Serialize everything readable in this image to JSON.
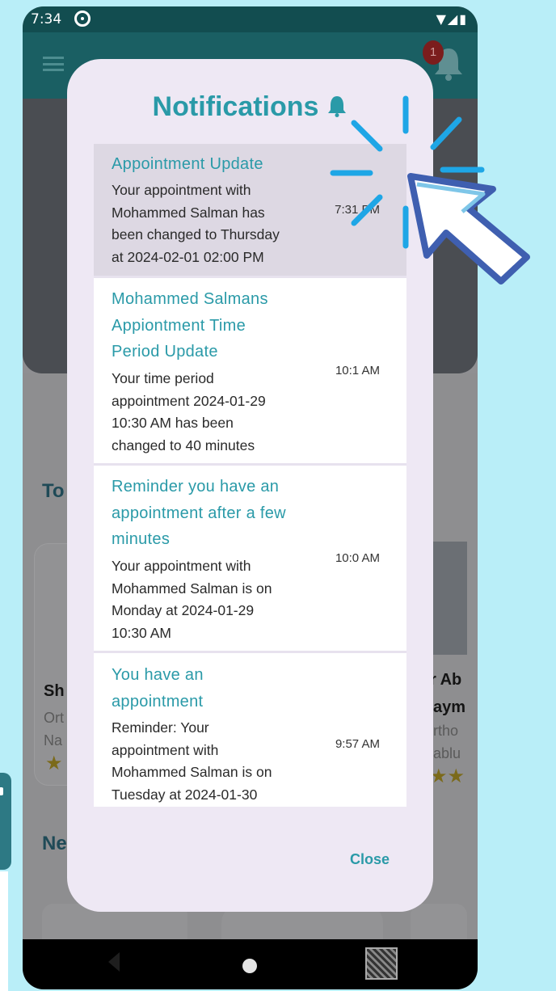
{
  "status_bar": {
    "time": "7:34",
    "right_icons": "▼◢▮"
  },
  "app_bar": {
    "badge_count": "1"
  },
  "background": {
    "section_1": "To",
    "section_2": "Ne",
    "card_left_name": "Sh",
    "card_left_spec": "Ort",
    "card_left_loc": "Na",
    "card_right_name": "r Ab",
    "card_right_name2": "aym",
    "card_right_spec": "rtho",
    "card_right_loc": "ablu"
  },
  "dialog": {
    "title": "Notifications",
    "close_label": "Close",
    "items": [
      {
        "title_lines": [
          "Appointment Update"
        ],
        "body_lines": [
          "Your appointment with",
          "Mohammed Salman has",
          "been changed to Thursday",
          "at 2024-02-01 02:00 PM"
        ],
        "time": "7:31 PM"
      },
      {
        "title_lines": [
          "Mohammed Salmans",
          "Appiontment Time",
          "Period Update"
        ],
        "body_lines": [
          "Your time period",
          "appointment 2024-01-29",
          "10:30 AM has been",
          "changed to 40 minutes"
        ],
        "time": "10:1 AM"
      },
      {
        "title_lines": [
          "Reminder you have an",
          "appointment after a few",
          "minutes"
        ],
        "body_lines": [
          "Your appointment with",
          "Mohammed Salman is on",
          "Monday at 2024-01-29",
          "10:30 AM"
        ],
        "time": "10:0 AM"
      },
      {
        "title_lines": [
          "You have an",
          "appointment"
        ],
        "body_lines": [
          "Reminder: Your",
          "appointment with",
          "Mohammed Salman is on",
          "Tuesday at 2024-01-30"
        ],
        "time": "9:57 AM"
      }
    ]
  },
  "colors": {
    "accent": "#2a9aa8",
    "dialog_bg": "#eee8f4",
    "page_bg": "#b9eef8",
    "pointer_outline": "#3f5fb0"
  }
}
